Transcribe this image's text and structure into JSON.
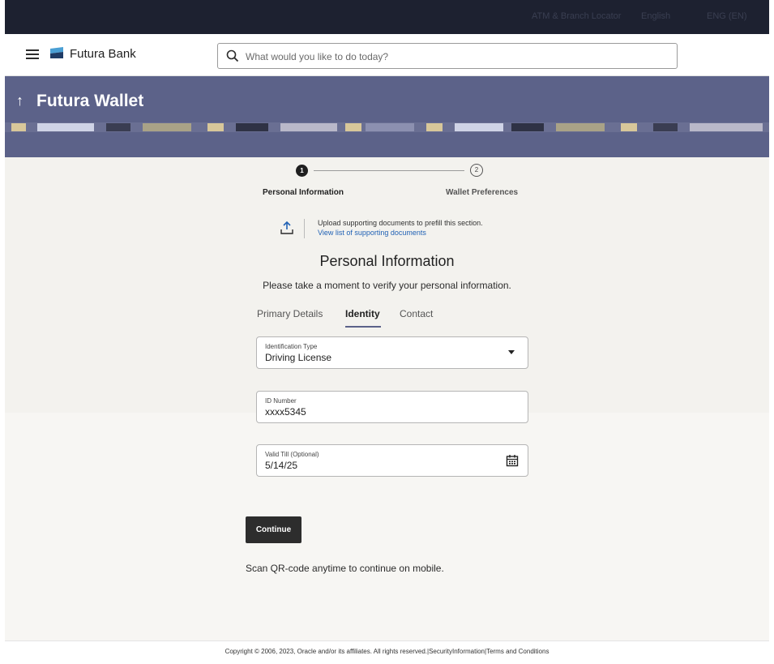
{
  "topbar": {
    "items": [
      "ATM & Branch Locator",
      "English",
      "ENG (EN)"
    ]
  },
  "header": {
    "brand": "Futura Bank",
    "search_placeholder": "What would you like to do today?"
  },
  "banner": {
    "title": "Futura Wallet"
  },
  "stepper": {
    "steps": [
      {
        "number": "1",
        "label": "Personal Information",
        "state": "active"
      },
      {
        "number": "2",
        "label": "Wallet Preferences",
        "state": "pending"
      }
    ]
  },
  "upload": {
    "text": "Upload supporting documents to prefill this section.",
    "link": "View list of supporting documents"
  },
  "page": {
    "title": "Personal Information",
    "subtitle": "Please take a moment to verify your personal information."
  },
  "tabs": [
    {
      "label": "Primary Details",
      "active": false
    },
    {
      "label": "Identity",
      "active": true
    },
    {
      "label": "Contact",
      "active": false
    }
  ],
  "form": {
    "id_type": {
      "label": "Identification Type",
      "value": "Driving License"
    },
    "id_number": {
      "label": "ID Number",
      "value": "xxxx5345"
    },
    "valid_till": {
      "label": "Valid Till (Optional)",
      "value": "5/14/25"
    }
  },
  "actions": {
    "continue_label": "Continue"
  },
  "qr_text": "Scan QR-code anytime to continue on mobile.",
  "footer": {
    "text": "Copyright © 2006, 2023, Oracle and/or its affiliates. All rights reserved.|SecurityInformation|Terms and Conditions"
  },
  "colors": {
    "topbar": "#1d2130",
    "banner": "#5c6289",
    "link": "#2162b5",
    "button": "#2d2d2d"
  }
}
